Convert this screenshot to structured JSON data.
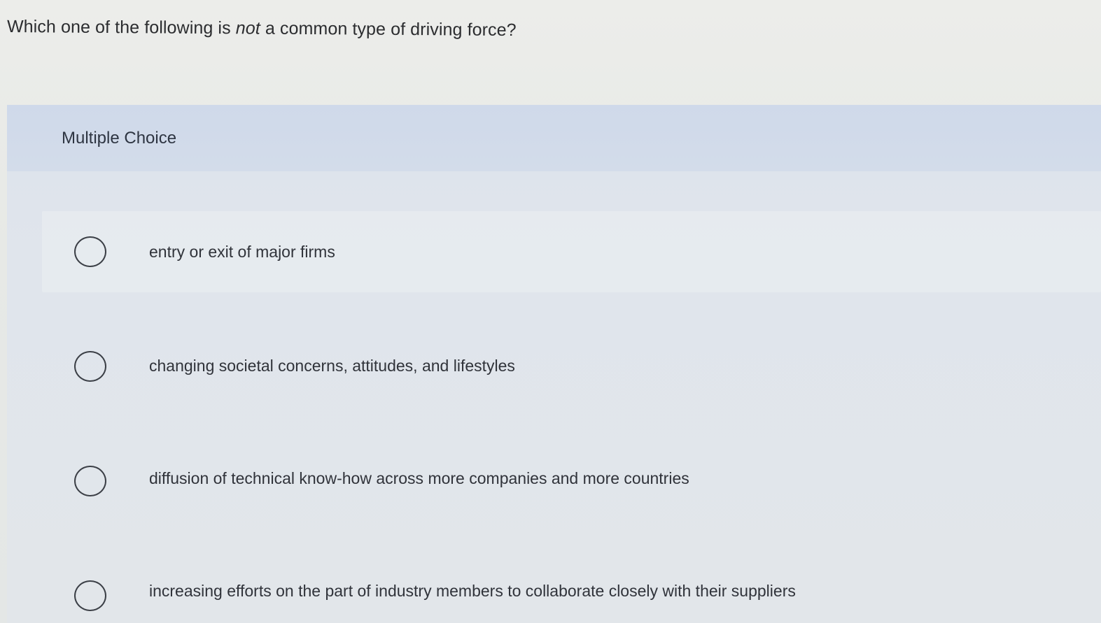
{
  "question": {
    "before": "Which one of the following is ",
    "emphasis": "not",
    "after": " a common type of driving force?"
  },
  "multiple_choice": {
    "header": "Multiple Choice",
    "options": [
      {
        "label": "entry or exit of major firms",
        "selected": false
      },
      {
        "label": "changing societal concerns, attitudes, and lifestyles",
        "selected": false
      },
      {
        "label": "diffusion of technical know-how across more companies and more countries",
        "selected": false
      },
      {
        "label": "increasing efforts on the part of industry members to collaborate closely with their suppliers",
        "selected": false
      }
    ]
  }
}
